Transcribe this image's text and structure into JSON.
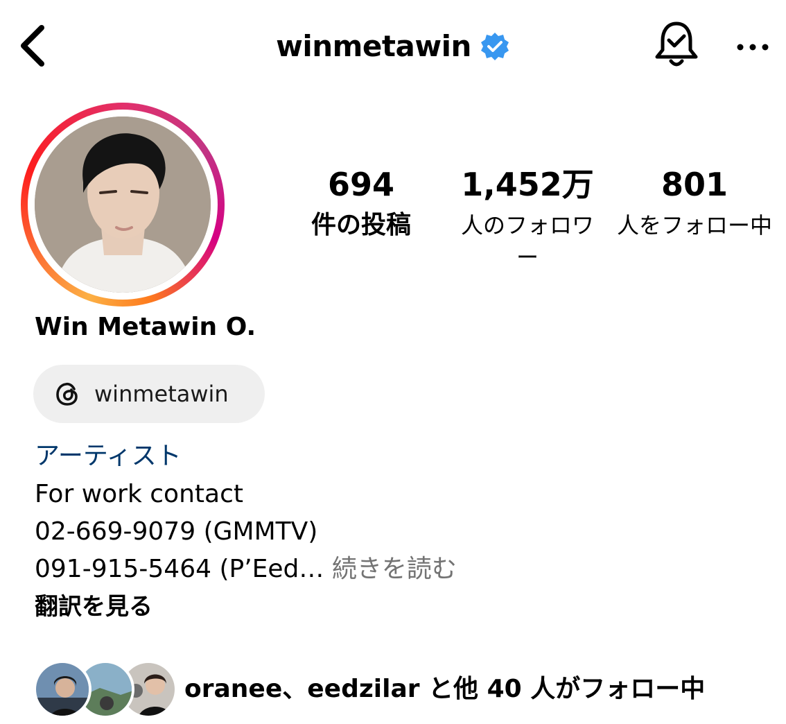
{
  "header": {
    "username": "winmetawin"
  },
  "stats": [
    {
      "value": "694",
      "label": "件の投稿"
    },
    {
      "value": "1,452万",
      "label": "人のフォロワー"
    },
    {
      "value": "801",
      "label": "人をフォロー中"
    }
  ],
  "profile": {
    "display_name": "Win Metawin O.",
    "threads_handle": "winmetawin",
    "category": "アーティスト",
    "bio_lines": [
      "For work contact",
      "02-669-9079 (GMMTV)",
      "091-915-5464 (P’Eed…"
    ],
    "more_label": "続きを読む",
    "translate_label": "翻訳を見る"
  },
  "followed_by": {
    "text": "oranee、eedzilar と他 40 人がフォロー中"
  },
  "colors": {
    "verified": "#3897f0",
    "category": "#00376b",
    "muted": "#737373",
    "chip_bg": "#efefef"
  }
}
